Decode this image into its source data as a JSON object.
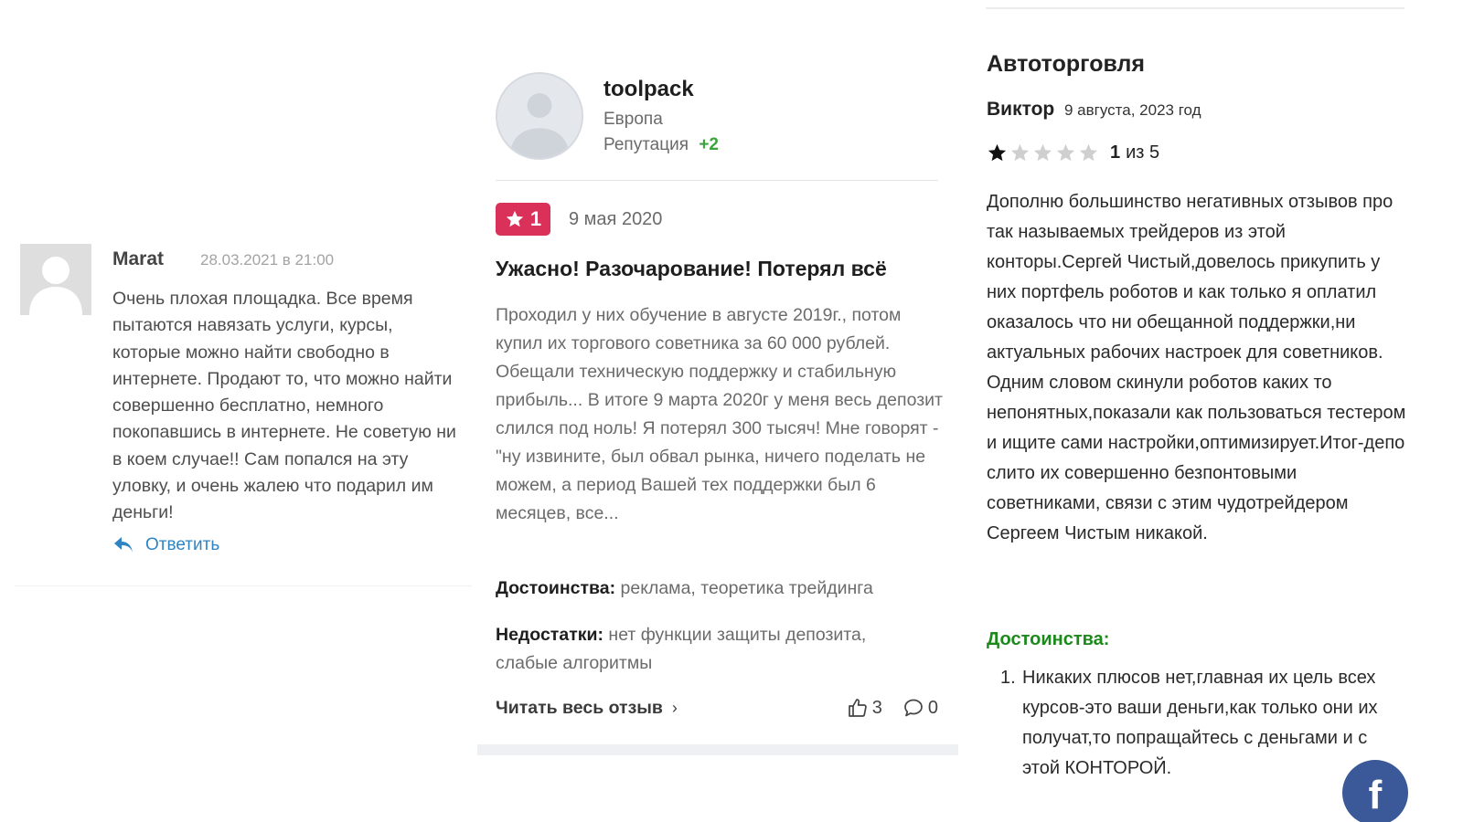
{
  "left_review": {
    "author": "Marat",
    "date": "28.03.2021 в 21:00",
    "text": "Очень плохая площадка. Все время пытаются навязать услуги, курсы, которые можно найти свободно в интернете. Продают то, что можно найти совершенно бесплатно, немного покопавшись в интернете. Не советую ни в коем случае!! Сам попался на эту уловку, и очень жалею что подарил им деньги!",
    "reply_label": "Ответить",
    "reply_icon": "reply-arrow-icon",
    "avatar_icon": "default-user-avatar"
  },
  "middle_review": {
    "username": "toolpack",
    "region": "Европа",
    "reputation_label": "Репутация",
    "reputation_value": "+2",
    "rating": "1",
    "rating_color": "#d9315a",
    "date": "9 мая 2020",
    "title": "Ужасно! Разочарование! Потерял всё",
    "body": "Проходил у них обучение в августе 2019г., потом купил их торгового советника за 60 000 рублей. Обещали техническую поддержку и стабильную прибыль... В итоге 9 марта 2020г у меня весь депозит слился под ноль! Я потерял 300 тысяч! Мне говорят - \"ну извините, был обвал рынка, ничего поделать не можем, а период Вашей тех поддержки был 6 месяцев, все...",
    "pros_label": "Достоинства:",
    "pros": "реклама, теоретика трейдинга",
    "cons_label": "Недостатки:",
    "cons": "нет функции защиты депозита, слабые алгоритмы",
    "read_more": "Читать весь отзыв",
    "likes": "3",
    "comments": "0",
    "avatar_icon": "default-user-avatar"
  },
  "right_review": {
    "category": "Автоторговля",
    "author": "Виктор",
    "date": "9 августа, 2023 год",
    "rating_value": 1,
    "rating_max": 5,
    "rating_number": "1",
    "rating_text": "из 5",
    "body": "Дополню большинство негативных отзывов про так называемых трейдеров из этой конторы.Сергей Чистый,довелось прикупить у них портфель роботов и как только я оплатил оказалось что ни обещанной поддержки,ни актуальных рабочих настроек для советников. Одним словом скинули роботов каких то непонятных,показали как пользоваться тестером и ищите сами настройки,оптимизирует.Итог-депо слито их совершенно безпонтовыми советниками, связи с этим чудотрейдером Сергеем Чистым никакой.",
    "pros_label": "Достоинства:",
    "pros_items": [
      {
        "num": "1.",
        "text": "Никаких плюсов нет,главная их цель всех курсов-это ваши деньги,как только они их получат,то попращайтесь с деньгами и с этой КОНТОРОЙ."
      }
    ],
    "pros_color": "#1b8a1b"
  },
  "facebook_button": {
    "label": "f",
    "color": "#3b5998"
  }
}
